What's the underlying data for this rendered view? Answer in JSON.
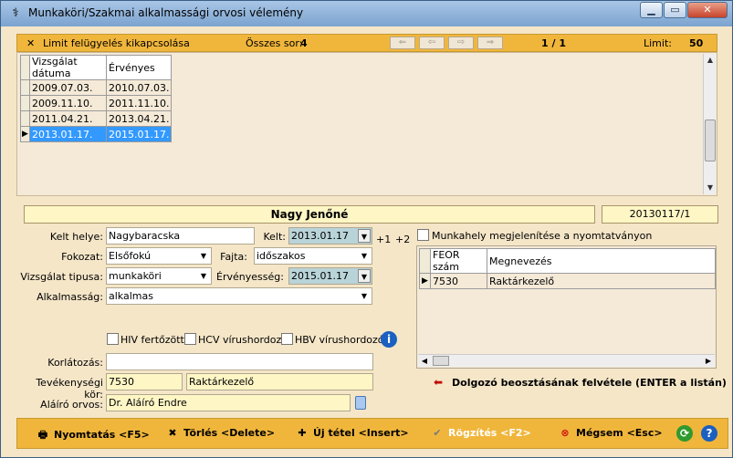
{
  "window": {
    "title": "Munkaköri/Szakmai alkalmassági orvosi vélemény",
    "minimize": "▁",
    "maximize": "▭",
    "close": "✕"
  },
  "topbar": {
    "limit_toggle": "Limit felügyelés kikapcsolása",
    "total_label": "Összes sor:",
    "total_value": "4",
    "page_indicator": "1 / 1",
    "limit_label": "Limit:",
    "limit_value": "50",
    "nav": [
      "⇐",
      "⇦",
      "⇨",
      "⇒"
    ]
  },
  "exam_table": {
    "columns": [
      "Vizsgálat dátuma",
      "Érvényes"
    ],
    "rows": [
      [
        "2009.07.03.",
        "2010.07.03."
      ],
      [
        "2009.11.10.",
        "2011.11.10."
      ],
      [
        "2011.04.21.",
        "2013.04.21."
      ],
      [
        "2013.01.17.",
        "2015.01.17."
      ]
    ],
    "selected_row": 3
  },
  "person": {
    "name": "Nagy Jenőné",
    "id": "20130117/1"
  },
  "form": {
    "kelt_helye_label": "Kelt helye:",
    "kelt_helye_value": "Nagybaracska",
    "kelt_label": "Kelt:",
    "kelt_value": "2013.01.17",
    "plus1": "+1",
    "plus2": "+2",
    "fokozat_label": "Fokozat:",
    "fokozat_value": "Elsőfokú",
    "fajta_label": "Fajta:",
    "fajta_value": "időszakos",
    "vizsgalat_label": "Vizsgálat tipusa:",
    "vizsgalat_value": "munkaköri",
    "ervenyesseg_label": "Érvényesség:",
    "ervenyesseg_value": "2015.01.17",
    "alkalmassag_label": "Alkalmasság:",
    "alkalmassag_value": "alkalmas",
    "hiv_label": "HIV fertőzött",
    "hcv_label": "HCV vírushordozó",
    "hbv_label": "HBV vírushordozó",
    "korlatozas_label": "Korlátozás:",
    "korlatozas_value": "",
    "tevekenysegi_label": "Tevékenységi kör:",
    "tevekenysegi_code": "7530",
    "tevekenysegi_name": "Raktárkezelő",
    "alairo_label": "Aláíró orvos:",
    "alairo_value": "Dr. Aláíró Endre",
    "munkahely_label": "Munkahely megjelenítése a nyomtatványon"
  },
  "feor_table": {
    "columns": [
      "FEOR szám",
      "Megnevezés"
    ],
    "rows": [
      [
        "7530",
        "Raktárkezelő"
      ]
    ]
  },
  "hint": "Dolgozó beosztásának felvétele (ENTER a listán)",
  "buttons": {
    "print": "Nyomtatás <F5>",
    "delete": "Törlés <Delete>",
    "new": "Új tétel <Insert>",
    "save": "Rögzítés <F2>",
    "cancel": "Mégsem <Esc>"
  }
}
